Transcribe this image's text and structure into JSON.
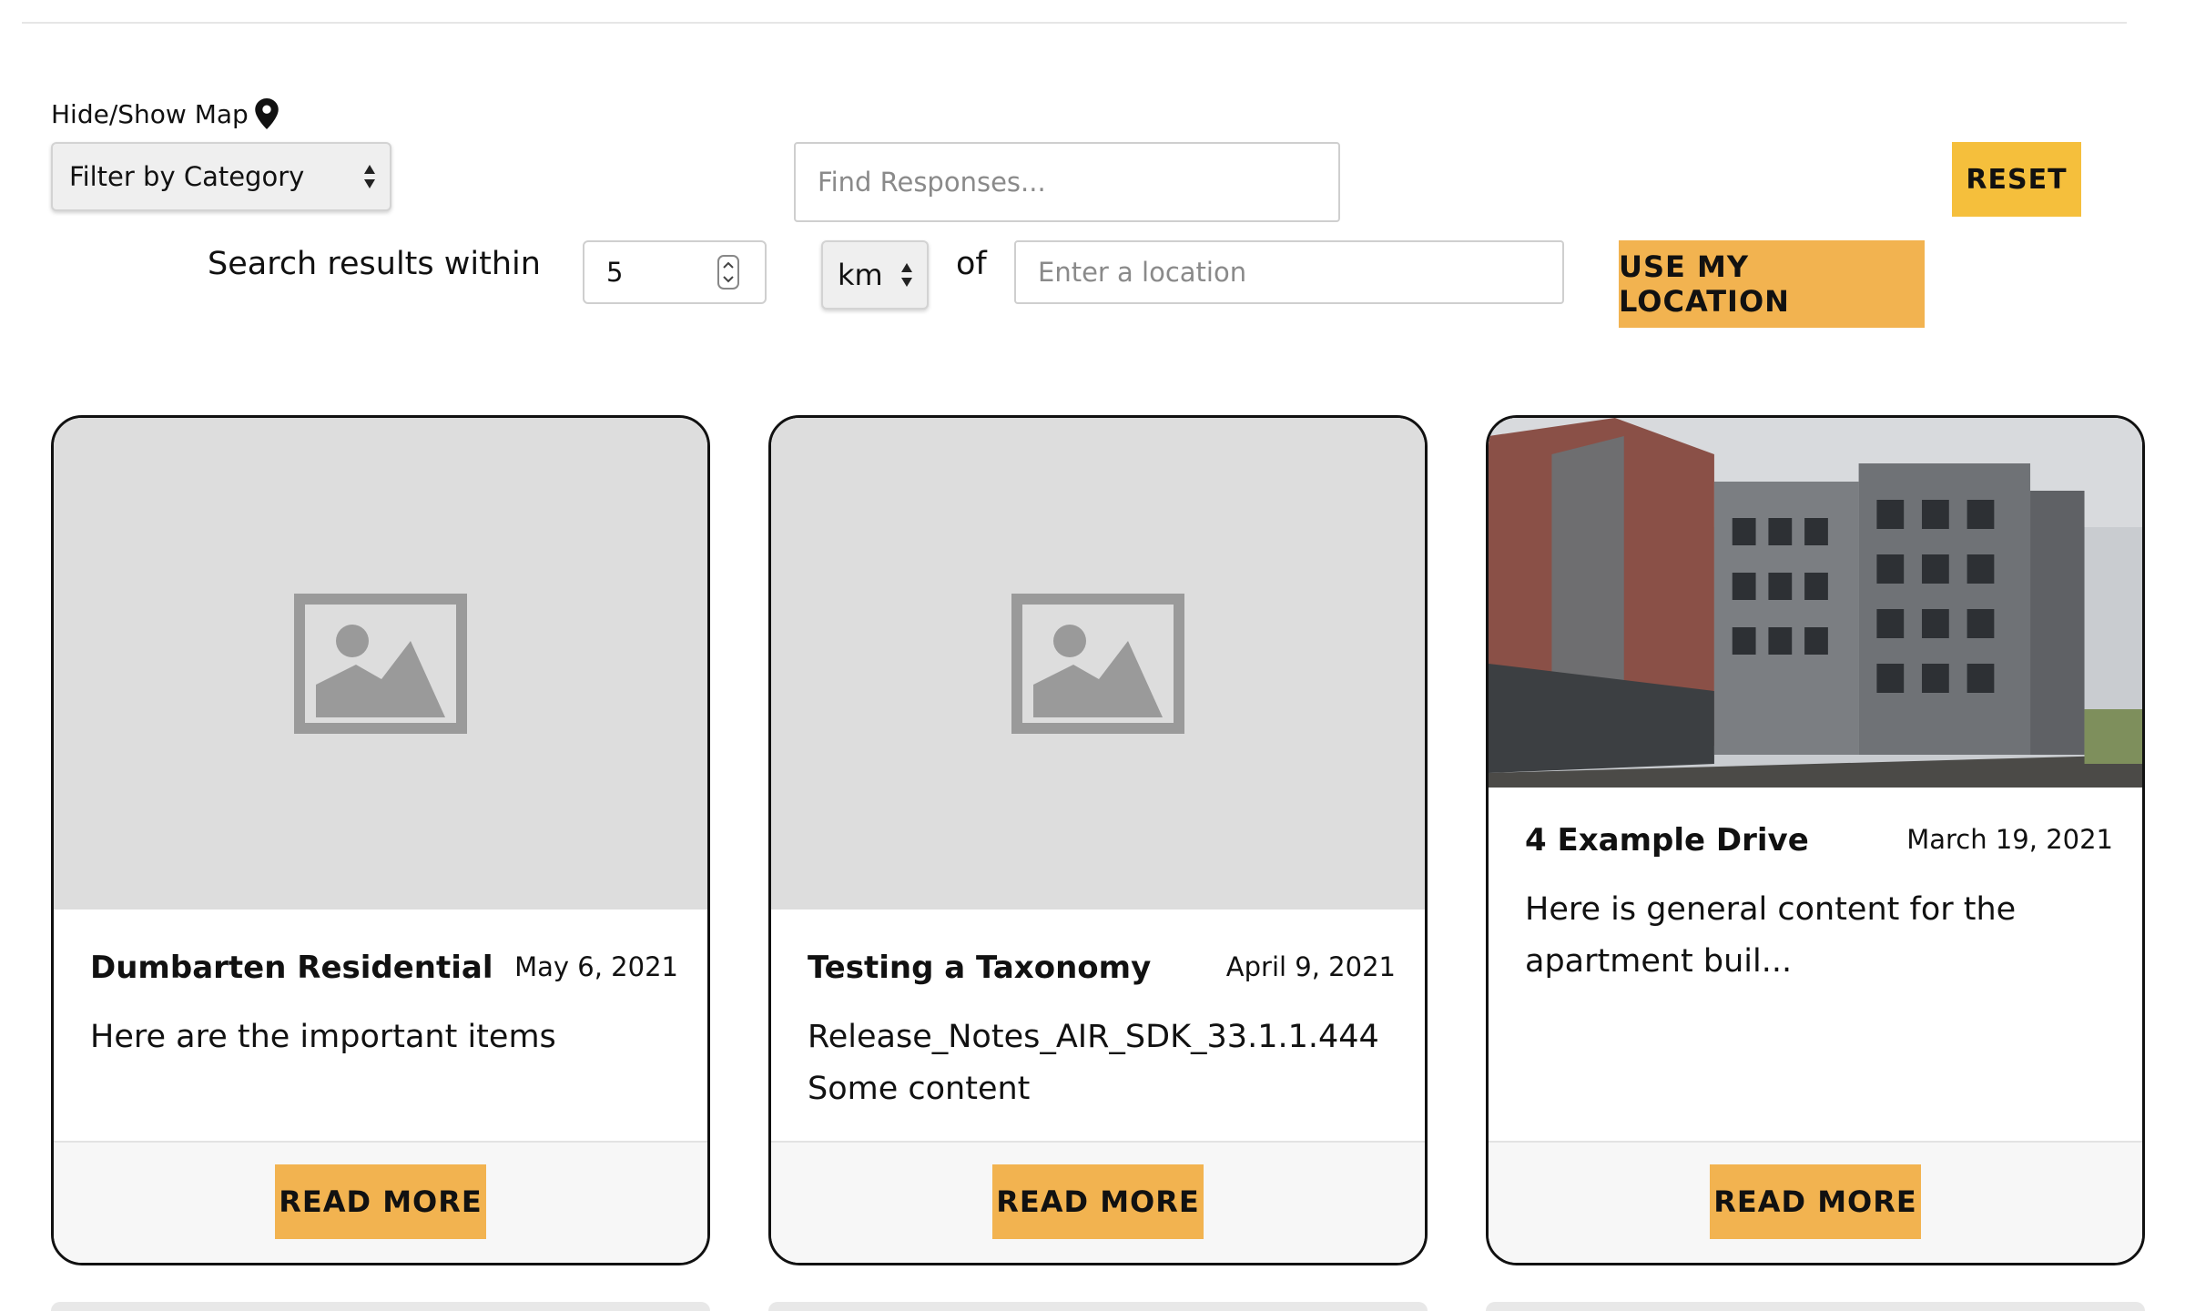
{
  "filters": {
    "map_toggle_label": "Hide/Show Map",
    "category_select": "Filter by Category",
    "find_placeholder": "Find Responses...",
    "reset_label": "RESET",
    "within_label": "Search results within",
    "radius_value": "5",
    "unit_value": "km",
    "of_label": "of",
    "location_placeholder": "Enter a location",
    "use_location_label": "USE MY LOCATION"
  },
  "cards": [
    {
      "title": "Dumbarten Residential",
      "date": "May 6, 2021",
      "excerpt": "Here are the important items",
      "button": "READ MORE",
      "image": "placeholder-image-icon"
    },
    {
      "title": "Testing a Taxonomy",
      "date": "April 9, 2021",
      "excerpt": "Release_Notes_AIR_SDK_33.1.1.444 Some content",
      "button": "READ MORE",
      "image": "placeholder-image-icon"
    },
    {
      "title": "4 Example Drive",
      "date": "March 19, 2021",
      "excerpt": "Here is general content for the apartment buil...",
      "button": "READ MORE",
      "image": "building-photo"
    }
  ],
  "colors": {
    "accent": "#f2b350",
    "reset_accent": "#f5bf3c",
    "placeholder_bg": "#dddddd",
    "placeholder_icon": "#9a9a9a"
  }
}
